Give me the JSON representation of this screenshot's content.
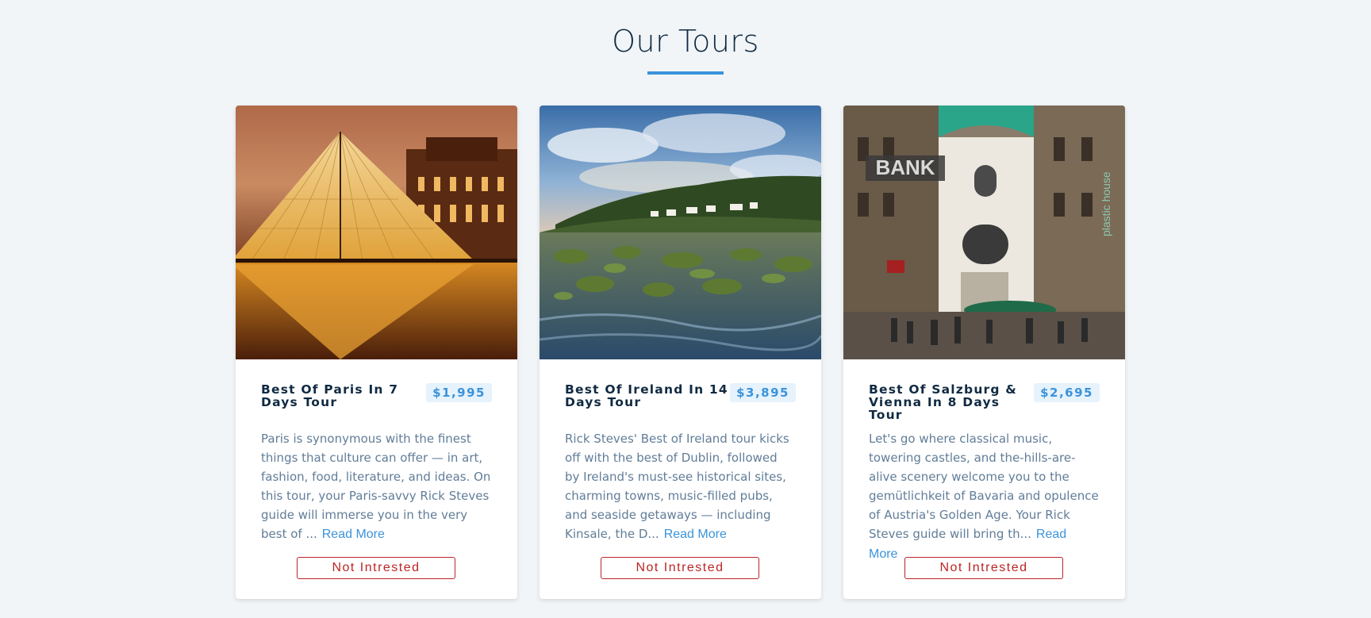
{
  "page": {
    "title": "Our Tours"
  },
  "tours": [
    {
      "name": "Best Of Paris In 7 Days Tour",
      "price": "$1,995",
      "info": "Paris is synonymous with the finest things that culture can offer — in art, fashion, food, literature, and ideas. On this tour, your Paris-savvy Rick Steves guide will immerse you in the very best of ...",
      "read_more": "Read More",
      "button": "Not Intrested"
    },
    {
      "name": "Best Of Ireland In 14 Days Tour",
      "price": "$3,895",
      "info": "Rick Steves' Best of Ireland tour kicks off with the best of Dublin, followed by Ireland's must-see historical sites, charming towns, music-filled pubs, and seaside getaways — including Kinsale, the D...",
      "read_more": "Read More",
      "button": "Not Intrested"
    },
    {
      "name": "Best Of Salzburg & Vienna In 8 Days Tour",
      "price": "$2,695",
      "info": "Let's go where classical music, towering castles, and the-hills-are-alive scenery welcome you to the gemütlichkeit of Bavaria and opulence of Austria's Golden Age. Your Rick Steves guide will bring th...",
      "read_more": "Read More",
      "button": "Not Intrested",
      "image_signs": {
        "bank": "BANK",
        "shop": "plastic house"
      }
    }
  ],
  "colors": {
    "background": "#f1f5f8",
    "accent": "#3b93db",
    "title": "#102a42",
    "text": "#617d98",
    "danger": "#bb2525"
  }
}
